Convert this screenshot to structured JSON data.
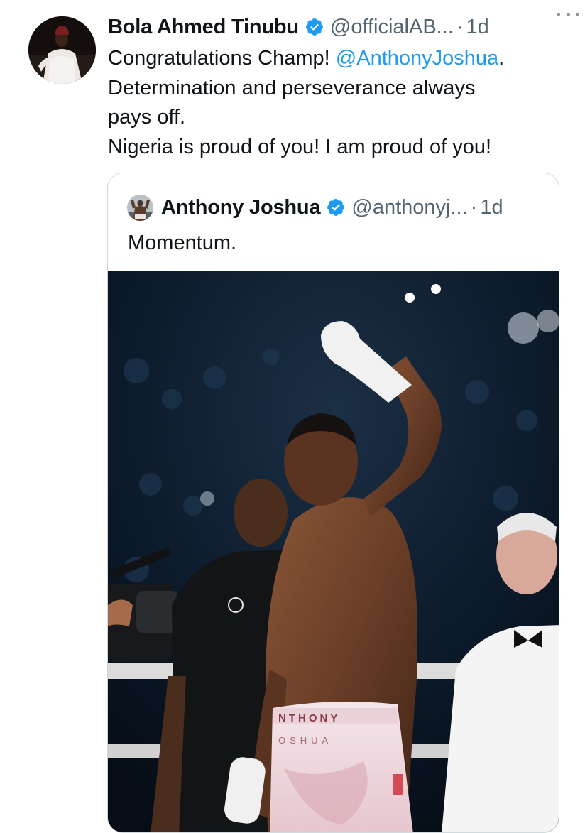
{
  "tweet": {
    "author_name": "Bola Ahmed Tinubu",
    "handle": "@officialAB...",
    "separator": "·",
    "time": "1d",
    "text": {
      "line1_prefix": "Congratulations Champ! ",
      "line1_mention": "@AnthonyJoshua",
      "line1_suffix": ".",
      "line2": "Determination and perseverance always",
      "line3": "pays off.",
      "line4": "Nigeria is proud of you! I am proud of you!"
    },
    "verified_icon": "verified-badge-icon",
    "more_icon": "more-options-icon"
  },
  "quoted": {
    "author_name": "Anthony Joshua",
    "handle": "@anthonyj...",
    "separator": "·",
    "time": "1d",
    "text": "Momentum.",
    "shorts_waistband": "NTHONY",
    "shorts_lower": "OSHUA"
  },
  "colors": {
    "link": "#1d9bf0",
    "secondary_text": "#536471",
    "verified": "#1d9bf0",
    "border": "#cfd9de"
  }
}
